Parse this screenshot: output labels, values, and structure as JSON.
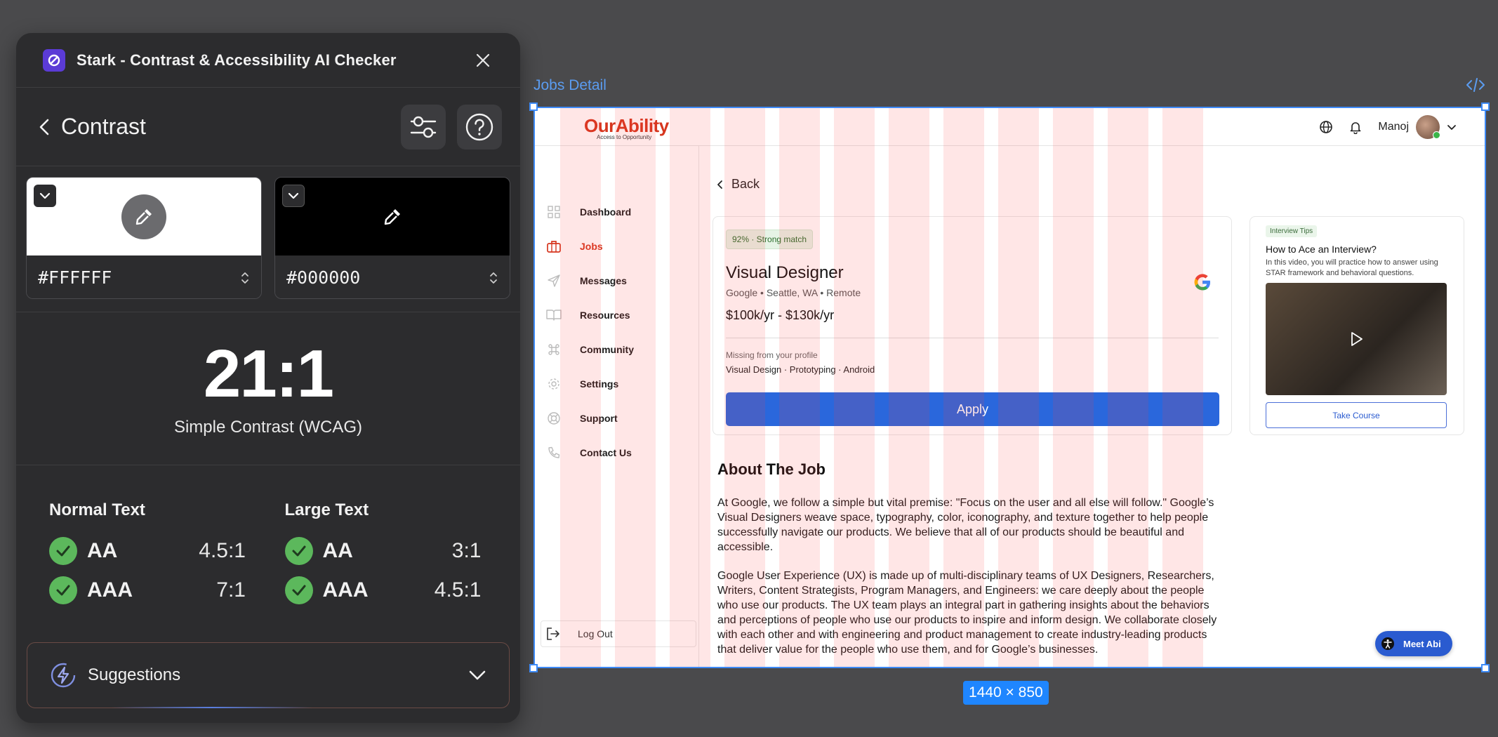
{
  "plugin": {
    "title": "Stark - Contrast & Accessibility AI Checker",
    "nav_title": "Contrast",
    "foreground": {
      "hex": "#FFFFFF",
      "color": "#FFFFFF"
    },
    "background": {
      "hex": "#000000",
      "color": "#000000"
    },
    "ratio": "21:1",
    "ratio_label": "Simple Contrast (WCAG)",
    "normal_text": {
      "title": "Normal Text",
      "rows": [
        {
          "level": "AA",
          "value": "4.5:1"
        },
        {
          "level": "AAA",
          "value": "7:1"
        }
      ]
    },
    "large_text": {
      "title": "Large Text",
      "rows": [
        {
          "level": "AA",
          "value": "3:1"
        },
        {
          "level": "AAA",
          "value": "4.5:1"
        }
      ]
    },
    "suggestions_label": "Suggestions",
    "pass_color": "#5CB85C"
  },
  "frame": {
    "name": "Jobs Detail",
    "size": "1440 × 850"
  },
  "app": {
    "brand": "OurAbility",
    "tagline": "Access to Opportunity",
    "user_name": "Manoj",
    "nav": [
      {
        "label": "Dashboard",
        "icon": "grid-icon"
      },
      {
        "label": "Jobs",
        "icon": "briefcase-icon"
      },
      {
        "label": "Messages",
        "icon": "send-icon"
      },
      {
        "label": "Resources",
        "icon": "book-icon"
      },
      {
        "label": "Community",
        "icon": "command-icon"
      },
      {
        "label": "Settings",
        "icon": "gear-icon"
      },
      {
        "label": "Support",
        "icon": "lifebuoy-icon"
      },
      {
        "label": "Contact Us",
        "icon": "phone-icon"
      }
    ],
    "logout": "Log Out",
    "back": "Back",
    "job": {
      "match": "92%  ·  Strong match",
      "title": "Visual Designer",
      "meta": "Google   •   Seattle, WA   •   Remote",
      "salary": "$100k/yr - $130k/yr",
      "missing_label": "Missing from your profile",
      "missing_skills": "Visual Design  ·  Prototyping  ·  Android",
      "apply": "Apply"
    },
    "tip": {
      "badge": "Interview Tips",
      "title": "How to Ace an Interview?",
      "desc": "In this video, you will practice how to answer using STAR framework and behavioral questions.",
      "button": "Take Course"
    },
    "about": {
      "title": "About The Job",
      "p1": "At Google, we follow a simple but vital premise: \"Focus on the user and all else will follow.\" Google’s Visual Designers weave space, typography, color, iconography, and texture together to help people successfully navigate our products. We believe that all of our products should be beautiful and accessible.",
      "p2": "Google User Experience (UX) is made up of multi-disciplinary teams of UX Designers, Researchers, Writers, Content Strategists, Program Managers, and Engineers: we care deeply about the people who use our products. The UX team plays an integral part in gathering insights about the behaviors and perceptions of people who use our products to inspire and inform design. We collaborate closely with each other and with engineering and product management to create industry-leading products that deliver value for the people who use them, and for Google’s businesses."
    },
    "meet_abi": "Meet Abi",
    "accent": "#D6361E",
    "primary": "#2A67DC"
  }
}
